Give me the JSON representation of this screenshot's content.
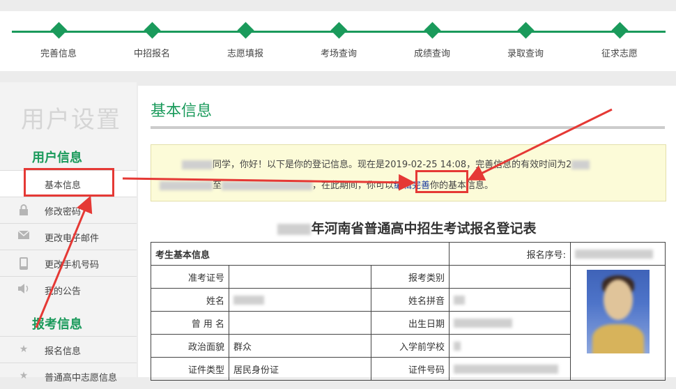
{
  "steps": [
    {
      "label": "完善信息"
    },
    {
      "label": "中招报名"
    },
    {
      "label": "志愿填报"
    },
    {
      "label": "考场查询"
    },
    {
      "label": "成绩查询"
    },
    {
      "label": "录取查询"
    },
    {
      "label": "征求志愿"
    }
  ],
  "sidebar": {
    "title": "用户设置",
    "section_user": "用户信息",
    "section_apply": "报考信息",
    "items": [
      {
        "label": "基本信息",
        "icon": "none"
      },
      {
        "label": "修改密码",
        "icon": "lock-icon"
      },
      {
        "label": "更改电子邮件",
        "icon": "mail-icon"
      },
      {
        "label": "更改手机号码",
        "icon": "phone-icon"
      },
      {
        "label": "我的公告",
        "icon": "speaker-icon"
      },
      {
        "label": "报名信息",
        "icon": "star-icon"
      },
      {
        "label": "普通高中志愿信息",
        "icon": "star-icon"
      }
    ]
  },
  "main": {
    "title": "基本信息",
    "notice": {
      "greeting": "同学，你好！以下是你的登记信息。现在是2019-02-25 14:08，完善信息的有效时间为2",
      "to": "至",
      "during": "，在此期间，你可以",
      "edit_link": "编辑完善",
      "tail": "你的基本信息。"
    },
    "form_title": "年河南省普通高中招生考试报名登记表",
    "table": {
      "section_header": "考生基本信息",
      "reg_no_label": "报名序号:",
      "rows": [
        {
          "l1": "准考证号",
          "v1": "",
          "l2": "报考类别",
          "v2": ""
        },
        {
          "l1": "姓名",
          "v1": "",
          "l2": "姓名拼音",
          "v2": ""
        },
        {
          "l1": "曾 用 名",
          "v1": "",
          "l2": "出生日期",
          "v2": ""
        },
        {
          "l1": "政治面貌",
          "v1": "群众",
          "l2": "入学前学校",
          "v2": ""
        },
        {
          "l1": "证件类型",
          "v1": "居民身份证",
          "l2": "证件号码",
          "v2": ""
        }
      ]
    }
  },
  "colors": {
    "accent": "#1a9a5b",
    "highlight": "#e53935",
    "notice_bg": "#fcfbd8"
  }
}
